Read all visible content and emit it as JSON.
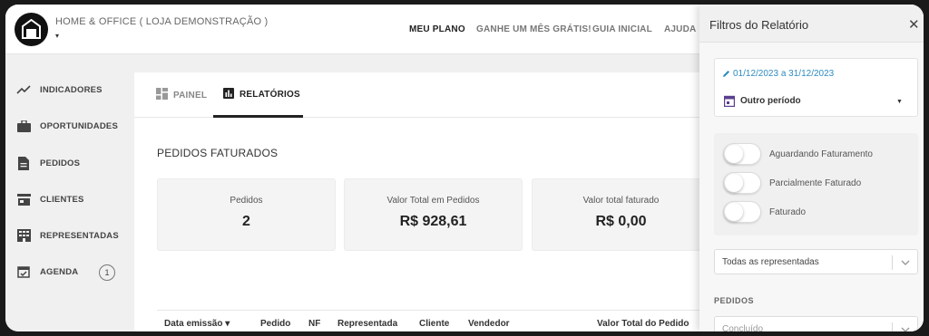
{
  "header": {
    "store_name": "HOME & OFFICE ( LOJA DEMONSTRAÇÃO )",
    "store_caret": "▾",
    "nav": [
      {
        "label": "MEU PLANO",
        "active": true
      },
      {
        "label": "GANHE UM MÊS GRÁTIS!",
        "active": false
      },
      {
        "label": "GUIA INICIAL",
        "active": false
      },
      {
        "label": "AJUDA",
        "active": false
      }
    ]
  },
  "sidebar": {
    "items": [
      {
        "label": "INDICADORES",
        "icon": "trending-up-icon"
      },
      {
        "label": "OPORTUNIDADES",
        "icon": "briefcase-icon"
      },
      {
        "label": "PEDIDOS",
        "icon": "document-icon"
      },
      {
        "label": "CLIENTES",
        "icon": "store-icon"
      },
      {
        "label": "REPRESENTADAS",
        "icon": "building-icon"
      },
      {
        "label": "AGENDA",
        "icon": "calendar-check-icon",
        "badge": "1"
      }
    ]
  },
  "main": {
    "tabs": [
      {
        "label": "PAINEL",
        "icon": "dashboard-icon",
        "active": false
      },
      {
        "label": "RELATÓRIOS",
        "icon": "bar-chart-icon",
        "active": true
      }
    ],
    "section_title": "PEDIDOS FATURADOS",
    "cards": [
      {
        "label": "Pedidos",
        "value": "2"
      },
      {
        "label": "Valor Total em Pedidos",
        "value": "R$ 928,61"
      },
      {
        "label": "Valor total faturado",
        "value": "R$ 0,00"
      }
    ],
    "table": {
      "columns": [
        "Data emissão ▾",
        "Pedido",
        "NF",
        "Representada",
        "Cliente",
        "Vendedor",
        "Valor Total do Pedido"
      ]
    }
  },
  "drawer": {
    "title": "Filtros do Relatório",
    "close": "✕",
    "date_range": "01/12/2023 a 31/12/2023",
    "period": "Outro período",
    "toggles": [
      {
        "label": "Aguardando Faturamento",
        "on": false
      },
      {
        "label": "Parcialmente Faturado",
        "on": false
      },
      {
        "label": "Faturado",
        "on": false
      }
    ],
    "representadas_select": "Todas as representadas",
    "pedidos_label": "PEDIDOS",
    "pedidos_select": "Concluído"
  },
  "colors": {
    "accent_blue": "#2e8bc0",
    "dark": "#111111"
  }
}
